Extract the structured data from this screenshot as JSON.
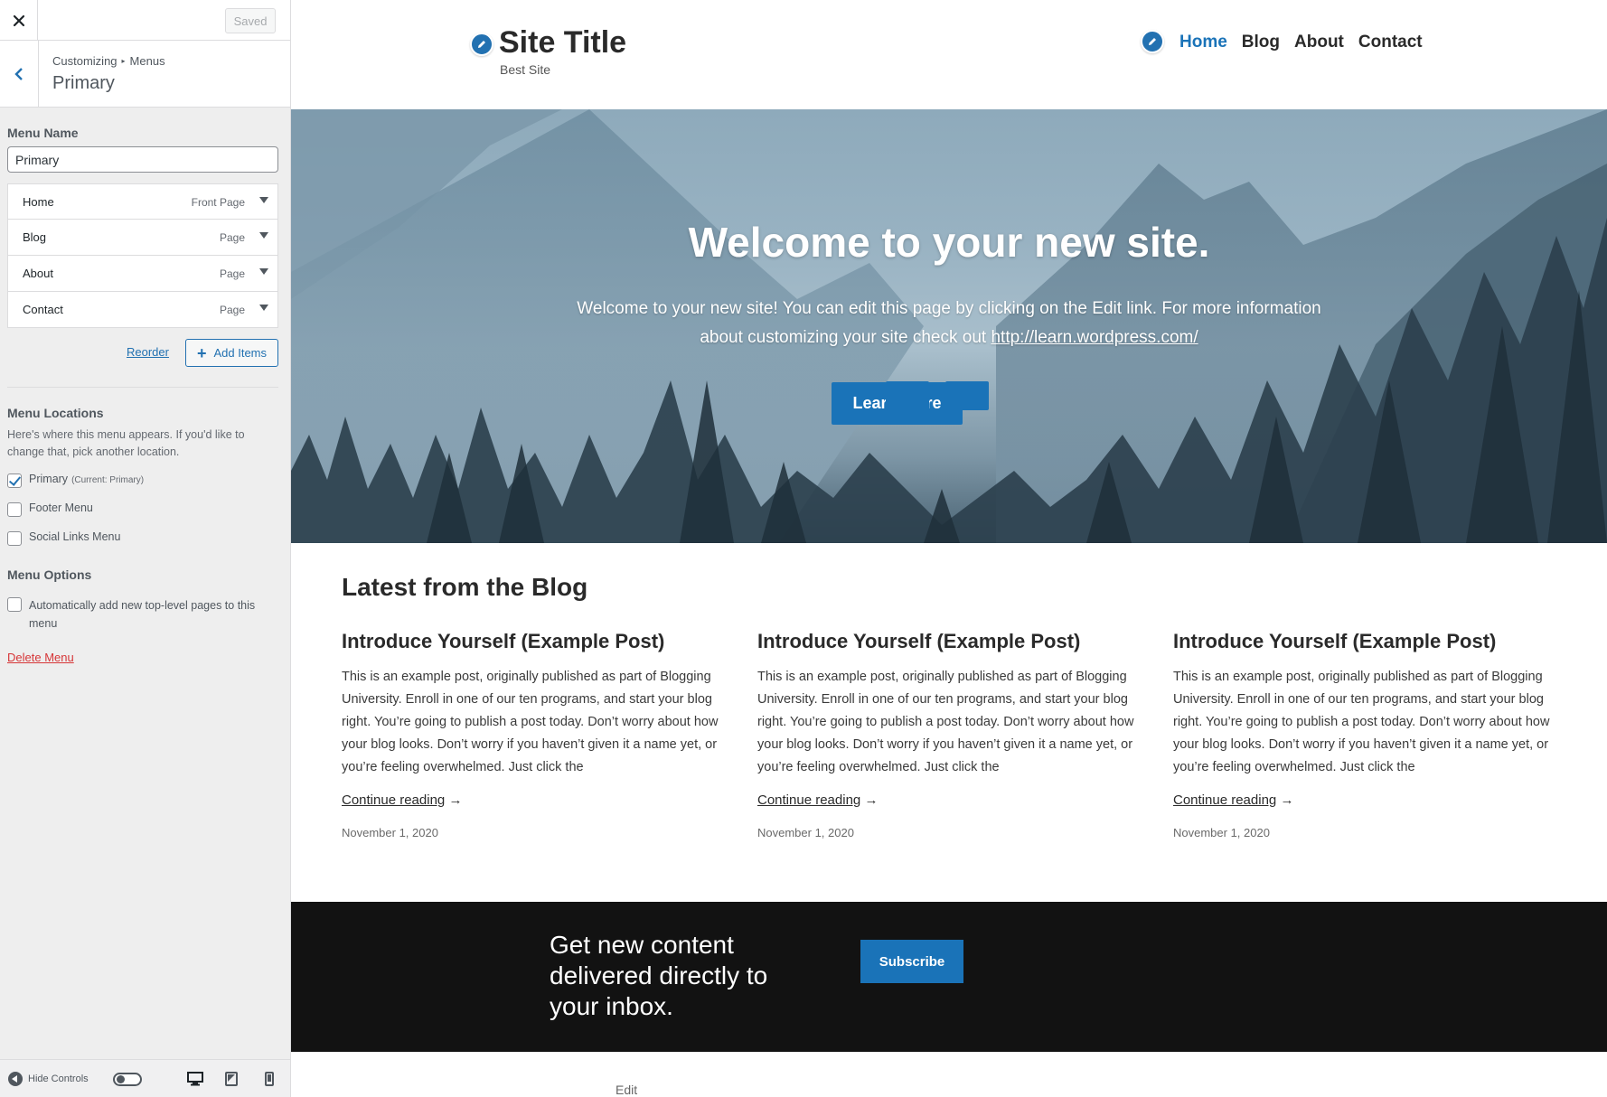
{
  "sidebar": {
    "saved_label": "Saved",
    "breadcrumb": {
      "root": "Customizing",
      "separator": "▸",
      "current": "Menus"
    },
    "section_title": "Primary",
    "menu_name_label": "Menu Name",
    "menu_name_value": "Primary",
    "menu_items": [
      {
        "title": "Home",
        "type": "Front Page"
      },
      {
        "title": "Blog",
        "type": "Page"
      },
      {
        "title": "About",
        "type": "Page"
      },
      {
        "title": "Contact",
        "type": "Page"
      }
    ],
    "reorder_label": "Reorder",
    "add_items_label": "Add Items",
    "menu_locations_label": "Menu Locations",
    "menu_locations_desc": "Here's where this menu appears. If you'd like to change that, pick another location.",
    "locations": [
      {
        "label": "Primary",
        "sub": "(Current: Primary)",
        "checked": true
      },
      {
        "label": "Footer Menu",
        "sub": "",
        "checked": false
      },
      {
        "label": "Social Links Menu",
        "sub": "",
        "checked": false
      }
    ],
    "menu_options_label": "Menu Options",
    "auto_add_label": "Automatically add new top-level pages to this menu",
    "delete_menu_label": "Delete Menu",
    "hide_controls_label": "Hide Controls"
  },
  "preview": {
    "site_title": "Site Title",
    "site_tagline": "Best Site",
    "nav": [
      {
        "label": "Home",
        "active": true
      },
      {
        "label": "Blog",
        "active": false
      },
      {
        "label": "About",
        "active": false
      },
      {
        "label": "Contact",
        "active": false
      }
    ],
    "hero": {
      "title": "Welcome to your new site.",
      "text_before": "Welcome to your new site! You can edit this page by clicking on the Edit link. For more information about customizing your site check out ",
      "link": "http://learn.wordpress.com/",
      "button": "Learn more"
    },
    "blog": {
      "heading": "Latest from the Blog",
      "posts": [
        {
          "title": "Introduce Yourself (Example Post)",
          "excerpt": "This is an example post, originally published as part of Blogging University. Enroll in one of our ten programs, and start your blog right. You’re going to publish a post today. Don’t worry about how your blog looks. Don’t worry if you haven’t given it a name yet, or you’re feeling overwhelmed. Just click the",
          "more": "Continue reading",
          "arrow": "→",
          "date": "November 1, 2020"
        },
        {
          "title": "Introduce Yourself (Example Post)",
          "excerpt": "This is an example post, originally published as part of Blogging University. Enroll in one of our ten programs, and start your blog right. You’re going to publish a post today. Don’t worry about how your blog looks. Don’t worry if you haven’t given it a name yet, or you’re feeling overwhelmed. Just click the",
          "more": "Continue reading",
          "arrow": "→",
          "date": "November 1, 2020"
        },
        {
          "title": "Introduce Yourself (Example Post)",
          "excerpt": "This is an example post, originally published as part of Blogging University. Enroll in one of our ten programs, and start your blog right. You’re going to publish a post today. Don’t worry about how your blog looks. Don’t worry if you haven’t given it a name yet, or you’re feeling overwhelmed. Just click the",
          "more": "Continue reading",
          "arrow": "→",
          "date": "November 1, 2020"
        }
      ]
    },
    "subscribe": {
      "text": "Get new content delivered directly to your inbox.",
      "button": "Subscribe"
    },
    "footer_edit": "Edit"
  },
  "colors": {
    "accent": "#2271b1",
    "site_blue": "#1a73b8",
    "danger": "#d63638",
    "band": "#121212"
  },
  "icons": {
    "close": "close-icon",
    "back": "chevron-left-icon",
    "edit": "pencil-icon",
    "plus": "plus-icon",
    "desktop": "desktop-icon",
    "tablet": "tablet-icon",
    "mobile": "mobile-icon"
  }
}
